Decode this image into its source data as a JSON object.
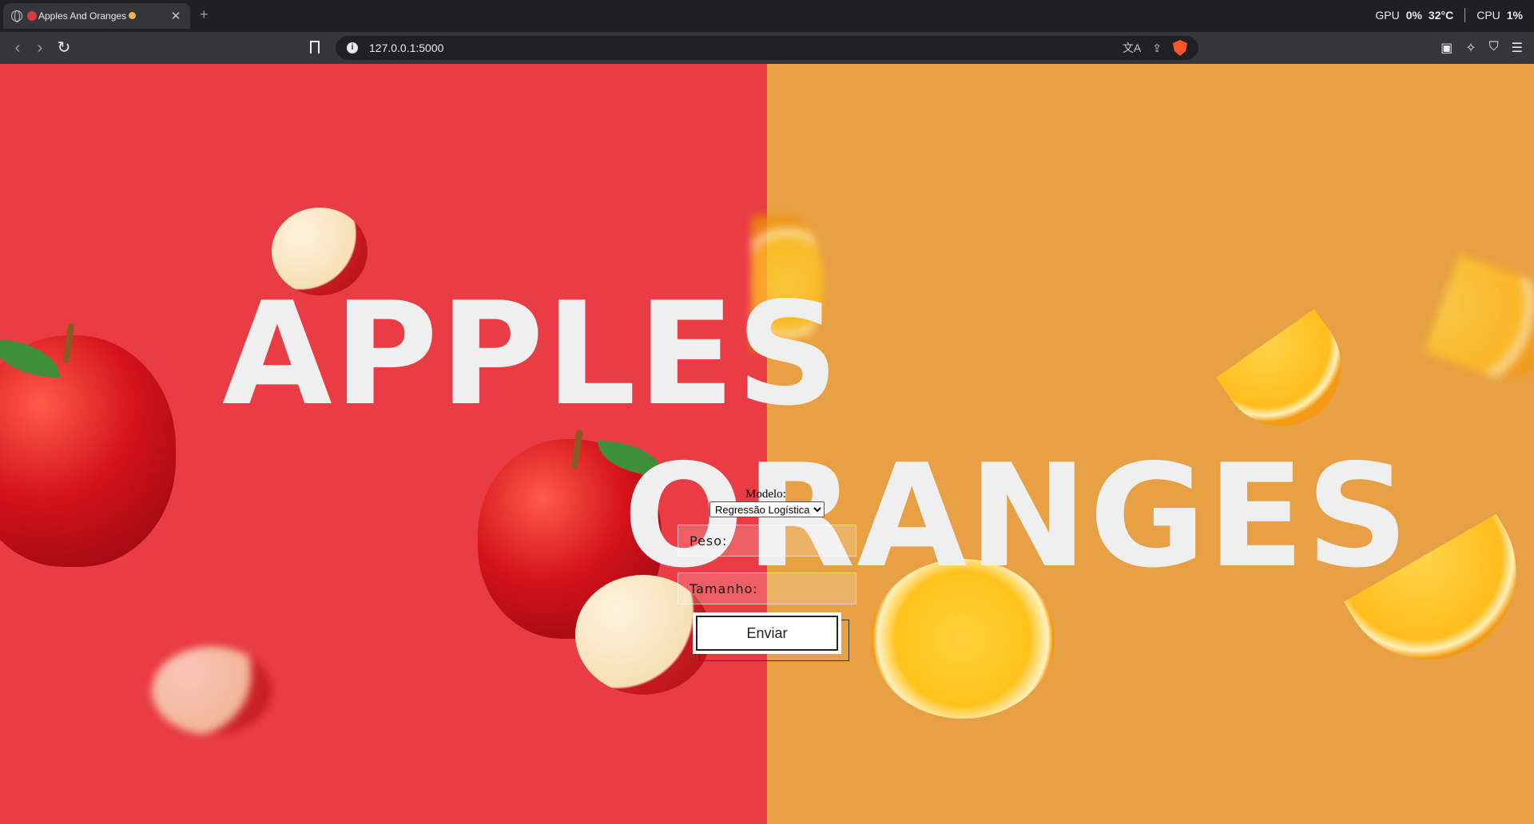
{
  "browser": {
    "tab_title": "Apples And Oranges",
    "new_tab_symbol": "+",
    "url": "127.0.0.1:5000",
    "stats": {
      "gpu_label": "GPU",
      "gpu_value": "0%",
      "temp_value": "32°C",
      "cpu_label": "CPU",
      "cpu_value": "1%"
    }
  },
  "hero": {
    "word1": "APPLES",
    "word2": "ORANGES",
    "left_color": "#e93c44",
    "right_color": "#e7a043"
  },
  "form": {
    "model_label": "Modelo:",
    "model_selected": "Regressão Logística",
    "peso_label": "Peso:",
    "tamanho_label": "Tamanho:",
    "submit_label": "Enviar"
  }
}
